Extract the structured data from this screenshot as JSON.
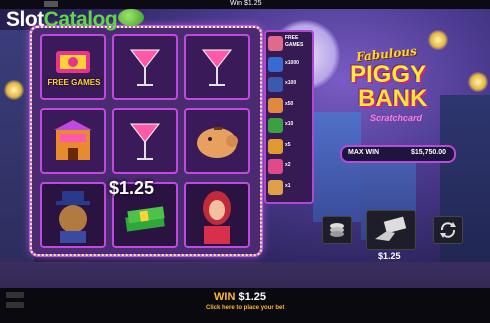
{
  "topbar": {
    "win_text": "Win $1.25"
  },
  "watermark": {
    "part1": "Slot",
    "part2": "Catalog"
  },
  "reels": {
    "free_games_label": "FREE GAMES",
    "win_amount": "$1.25",
    "symbols": [
      [
        "free-games-symbol",
        "cocktail-symbol",
        "cocktail-symbol"
      ],
      [
        "bank-building-symbol",
        "cocktail-symbol",
        "piggy-bank-symbol"
      ],
      [
        "gangster-pig-symbol",
        "cash-stack-symbol",
        "lady-symbol"
      ]
    ]
  },
  "paytable": [
    {
      "icon": "lady-icon",
      "text": "FREE GAMES",
      "color": "#e06a8a"
    },
    {
      "icon": "cocktail-icon",
      "text": "x1000",
      "color": "#3a6ad0"
    },
    {
      "icon": "gangster-icon",
      "text": "x100",
      "color": "#3a5ab0"
    },
    {
      "icon": "piggy-icon",
      "text": "x50",
      "color": "#e08a40"
    },
    {
      "icon": "cash-icon",
      "text": "x10",
      "color": "#3aa040"
    },
    {
      "icon": "building-icon",
      "text": "x5",
      "color": "#e09a30"
    },
    {
      "icon": "cocktail-icon",
      "text": "x2",
      "color": "#e04a8a"
    },
    {
      "icon": "cocktail-icon",
      "text": "x1",
      "color": "#e0a04a"
    }
  ],
  "title": {
    "line1": "Fabulous",
    "line2": "PIGGY",
    "line3": "BANK",
    "line4": "Scratchcard"
  },
  "max_win": {
    "label": "MAX WIN",
    "value": "$15,750.00"
  },
  "controls": {
    "bet_value": "$1.25"
  },
  "bottom": {
    "win_label": "WIN",
    "win_amount": "$1.25",
    "message": "Click here to place your bet"
  },
  "colors": {
    "accent": "#b94bd6",
    "gold": "#ffb82e",
    "green": "#5fd64a"
  }
}
